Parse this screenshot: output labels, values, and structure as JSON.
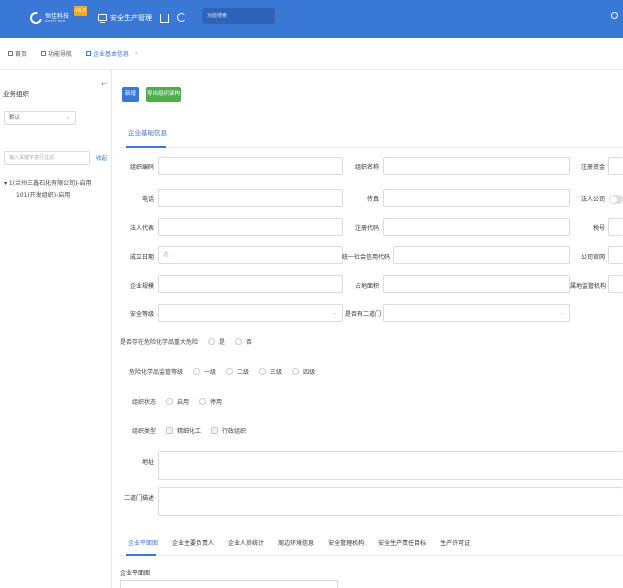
{
  "header": {
    "logo_text": "恒佳科技",
    "logo_sub": "SAFETY TECH",
    "version": "V6.0",
    "system_title": "安全生产管理",
    "search_placeholder": "功能搜索",
    "bar_color": "#3a78d6"
  },
  "breadcrumb": {
    "items": [
      "首页",
      "功能导航",
      "企业基本信息"
    ]
  },
  "sidebar": {
    "title": "业务组织",
    "select_value": "默认",
    "search_placeholder": "输入关键字进行过滤",
    "fold_label": "收起",
    "tree": [
      "1(兰州三鑫石化有限公司)-启用",
      "101(开发组织)-启用"
    ]
  },
  "toolbar": {
    "add_label": "新增",
    "export_label": "导出组织架构"
  },
  "form": {
    "section_title": "企业基础信息",
    "labels": {
      "org_code": "组织编码",
      "org_name": "组织名称",
      "reg_capital": "注册资金",
      "phone": "电话",
      "fax": "传真",
      "legal_company": "法人公司",
      "legal_rep": "法人代表",
      "reg_code": "注册代码",
      "tax_no": "税号",
      "found_date": "成立日期",
      "credit_code": "统一社会信用代码",
      "company_url": "公司官网",
      "scale": "企业规模",
      "area": "占地面积",
      "supervisor": "属地监管机构",
      "safety_level": "安全等级",
      "second_gate": "是否有二道门",
      "major_hazard": "是否存在危险化学品重大危险",
      "chem_level": "危险化学品监管等级",
      "org_status": "组织状态",
      "org_type": "组织类型",
      "address": "地址",
      "second_gate_desc": "二道门描述"
    },
    "found_date_placeholder": "选",
    "major_hazard_options": [
      "是",
      "否"
    ],
    "chem_level_options": [
      "一级",
      "二级",
      "三级",
      "四级"
    ],
    "org_status_options": [
      "启用",
      "停用"
    ],
    "org_type_options": [
      "精细化工",
      "行政组织"
    ]
  },
  "subtabs": {
    "items": [
      "企业平面图",
      "企业主要负责人",
      "企业人员统计",
      "周边环境信息",
      "安全管理机构",
      "安全生产责任目标",
      "生产许可证"
    ],
    "active_index": 0
  },
  "plan": {
    "label": "企业平面图"
  }
}
